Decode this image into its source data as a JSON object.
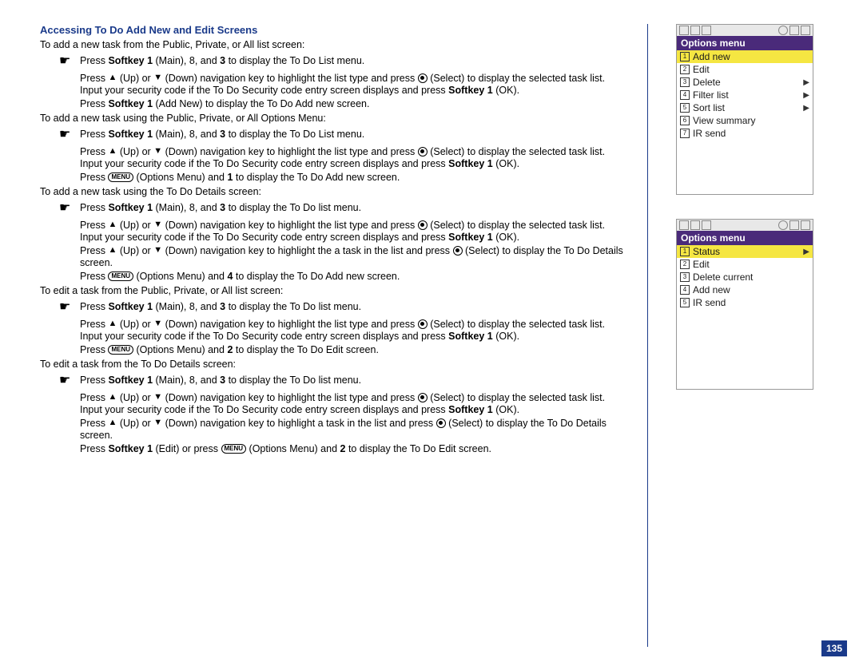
{
  "sectionTitle": "Accessing To Do Add New and Edit Screens",
  "intros": [
    "To add a new task from the Public, Private, or All list screen:",
    "To add a new task using the Public, Private, or All Options Menu:",
    "To add a new task using the To Do Details screen:",
    "To edit a task from the Public, Private, or All list screen:",
    "To edit a task from the To Do Details screen:"
  ],
  "softkey1": "Softkey 1",
  "main83": "(Main), 8,",
  "and3": "3",
  "todoListMenuCaps": "to display the To Do List menu.",
  "todoListMenuLower": "to display the To Do list menu.",
  "upLabel": "(Up) or",
  "downLabel": "(Down) navigation key to highlight the list type and press",
  "downTaskLabel": "(Down) navigation key to highlight the a task in the list and press",
  "downTaskLabel2": "(Down) navigation key to highlight a task in the list and press",
  "selectLabel": "(Select) to display the selected task list.",
  "selectDetails": "(Select) to display the To Do Details screen.",
  "securityLine": "Input your security code if the To Do Security code entry screen displays and press",
  "ok": "(OK).",
  "press": "Press",
  "addNewLine": "(Add New) to display the To Do Add new screen.",
  "optionsAnd1": "(Options Menu) and",
  "one": "1",
  "addNewScreen": "to display the To Do Add new screen.",
  "four": "4",
  "two": "2",
  "editScreen": "to display the To Do Edit screen.",
  "editOrPress": "(Edit) or press",
  "menuLabel": "MENU",
  "phone1": {
    "header": "Options menu",
    "items": [
      {
        "n": "1",
        "t": "Add new",
        "sel": true,
        "a": false
      },
      {
        "n": "2",
        "t": "Edit",
        "sel": false,
        "a": false
      },
      {
        "n": "3",
        "t": "Delete",
        "sel": false,
        "a": true
      },
      {
        "n": "4",
        "t": "Filter list",
        "sel": false,
        "a": true
      },
      {
        "n": "5",
        "t": "Sort list",
        "sel": false,
        "a": true
      },
      {
        "n": "6",
        "t": "View summary",
        "sel": false,
        "a": false
      },
      {
        "n": "7",
        "t": "IR send",
        "sel": false,
        "a": false
      }
    ]
  },
  "phone2": {
    "header": "Options menu",
    "items": [
      {
        "n": "1",
        "t": "Status",
        "sel": true,
        "a": true
      },
      {
        "n": "2",
        "t": "Edit",
        "sel": false,
        "a": false
      },
      {
        "n": "3",
        "t": "Delete current",
        "sel": false,
        "a": false
      },
      {
        "n": "4",
        "t": "Add new",
        "sel": false,
        "a": false
      },
      {
        "n": "5",
        "t": "IR send",
        "sel": false,
        "a": false
      }
    ]
  },
  "pageNumber": "135"
}
